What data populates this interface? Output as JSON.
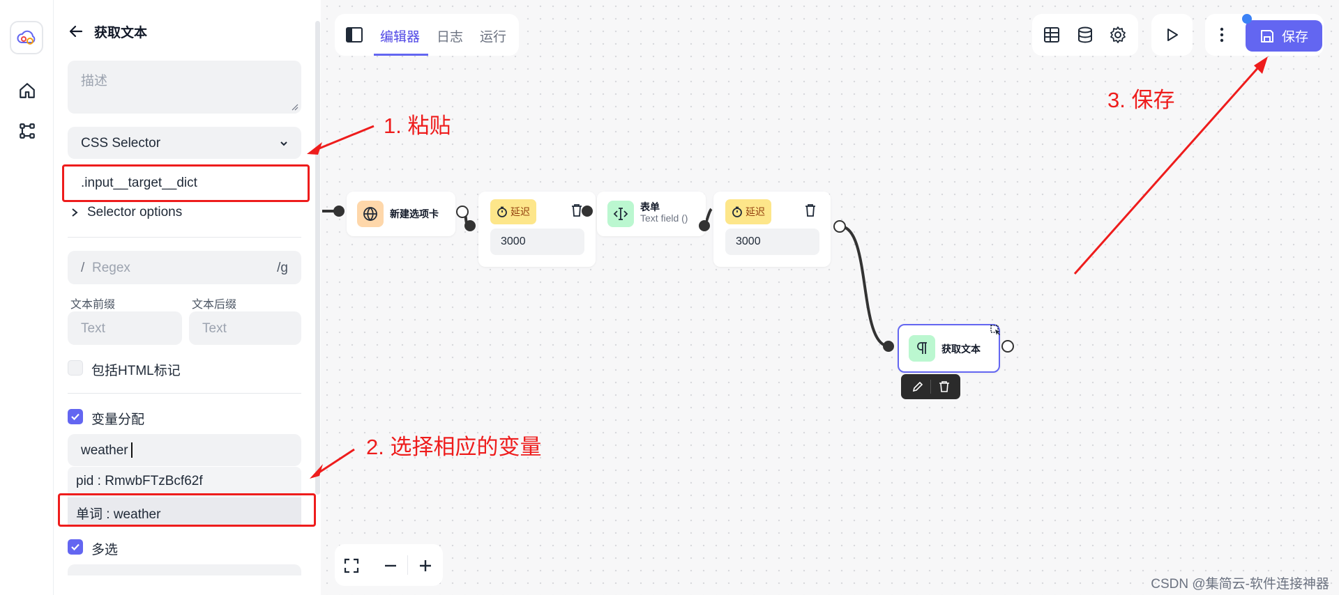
{
  "sidebar": {
    "title": "获取文本",
    "description_placeholder": "描述",
    "selector_type": "CSS Selector",
    "selector_value": ".input__target__dict",
    "selector_options_label": "Selector options",
    "regex_prefix": "/",
    "regex_placeholder": "Regex",
    "regex_suffix": "/g",
    "prefix_label": "文本前缀",
    "suffix_label": "文本后缀",
    "prefix_placeholder": "Text",
    "suffix_placeholder": "Text",
    "include_html_label": "包括HTML标记",
    "include_html_checked": false,
    "assign_variable_label": "变量分配",
    "assign_variable_checked": true,
    "variable_value": "weather",
    "suggestions": [
      "pid : RmwbFTzBcf62f",
      "单词 : weather"
    ],
    "multiple_label": "多选",
    "multiple_checked": true
  },
  "tabs": [
    "编辑器",
    "日志",
    "运行"
  ],
  "active_tab": "编辑器",
  "toolbar": {
    "save_label": "保存",
    "icons": [
      "table-icon",
      "database-icon",
      "settings-icon",
      "play-icon",
      "more-icon"
    ]
  },
  "nodes": {
    "new_tab": {
      "label": "新建选项卡"
    },
    "delay1": {
      "badge": "延迟",
      "value": "3000"
    },
    "form": {
      "label": "表单",
      "sub": "Text field ()"
    },
    "delay2": {
      "badge": "延迟",
      "value": "3000"
    },
    "get_text": {
      "label": "获取文本"
    }
  },
  "annotations": {
    "step1": "1. 粘贴",
    "step2": "2. 选择相应的变量",
    "step3": "3. 保存"
  },
  "watermark": "CSDN @集简云-软件连接神器",
  "colors": {
    "accent": "#6366f1",
    "annotation": "#ee1c1c",
    "delay_badge": "#fde68a"
  }
}
